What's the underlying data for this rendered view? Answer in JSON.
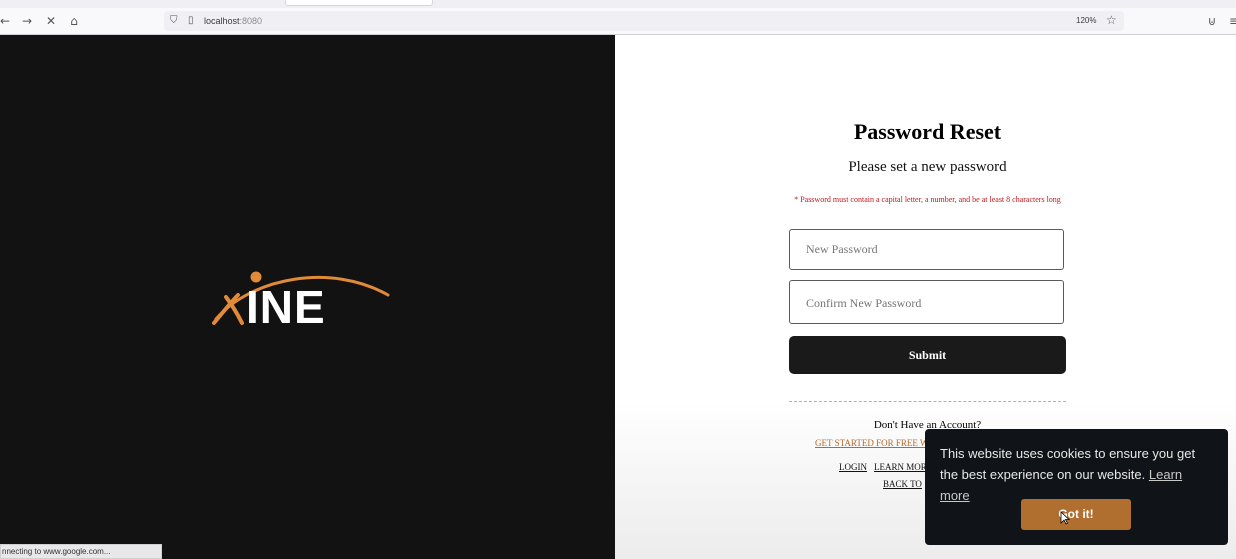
{
  "browser": {
    "url_host": "localhost",
    "url_port": ":8080",
    "zoom": "120%",
    "icons": [
      "back-icon",
      "forward-icon",
      "stop-icon",
      "home-icon",
      "shield-icon",
      "page-icon",
      "star-icon",
      "pocket-icon",
      "menu-icon"
    ],
    "status": "nnecting to www.google.com..."
  },
  "brand": {
    "logo_icon": "ine-logo-icon",
    "logo_letters": "INE",
    "accent": "#e08a3a"
  },
  "form": {
    "title": "Password Reset",
    "subtitle": "Please set a new password",
    "requirement": "* Password must contain a capital letter, a number, and be at least 8 characters long",
    "new_password_placeholder": "New Password",
    "confirm_password_placeholder": "Confirm New Password",
    "submit_label": "Submit",
    "error_color": "#c0161b"
  },
  "footer": {
    "no_account": "Don't Have an Account?",
    "get_started": "GET STARTED FOR FREE W",
    "login": "LOGIN",
    "learn_more": "LEARN MOR",
    "back_to": "BACK TO"
  },
  "cookie": {
    "message": "This website uses cookies to ensure you get the best experience on our website.",
    "learn_more": "Learn more",
    "button": "Got it!",
    "button_color": "#b06e2f"
  }
}
